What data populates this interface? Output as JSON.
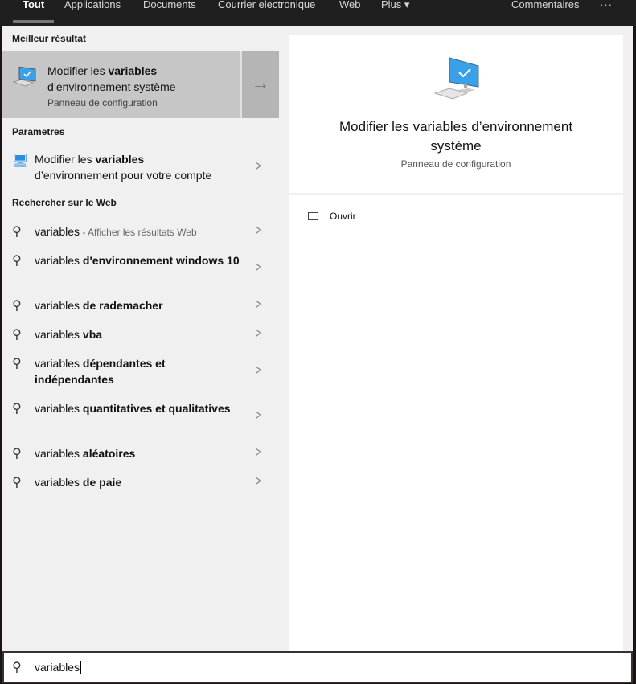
{
  "tabs": [
    {
      "label": "Tout",
      "active": true
    },
    {
      "label": "Applications"
    },
    {
      "label": "Documents"
    },
    {
      "label": "Courrier electronique"
    },
    {
      "label": "Web"
    },
    {
      "label": "Plus"
    }
  ],
  "more_arrow": "▾",
  "feedback": "Commentaires",
  "ellipsis": "···",
  "best": {
    "header": "Meilleur résultat",
    "title_pre": "Modifier les ",
    "title_bold": "variables",
    "title_line2": "d’environnement système",
    "subtitle": "Panneau de configuration",
    "arrow": "→"
  },
  "settings": {
    "header": "Parametres",
    "item": {
      "pre": "Modifier les ",
      "bold": "variables",
      "line2": "d’environnement pour votre compte"
    }
  },
  "web": {
    "header": "Rechercher sur le Web",
    "items": [
      {
        "pre": "variables",
        "bold": "",
        "hint": " - Afficher les résultats Web"
      },
      {
        "pre": "variables ",
        "bold": "d'environnement windows 10"
      },
      {
        "pre": "variables ",
        "bold": "de rademacher"
      },
      {
        "pre": "variables ",
        "bold": "vba"
      },
      {
        "pre": "variables ",
        "bold": "dépendantes et indépendantes"
      },
      {
        "pre": "variables ",
        "bold": "quantitatives et qualitatives"
      },
      {
        "pre": "variables ",
        "bold": "aléatoires"
      },
      {
        "pre": "variables ",
        "bold": "de paie"
      }
    ]
  },
  "preview": {
    "title": "Modifier les variables d’environnement système",
    "subtitle": "Panneau de configuration",
    "action": "Ouvrir"
  },
  "search": {
    "value": "variables"
  }
}
